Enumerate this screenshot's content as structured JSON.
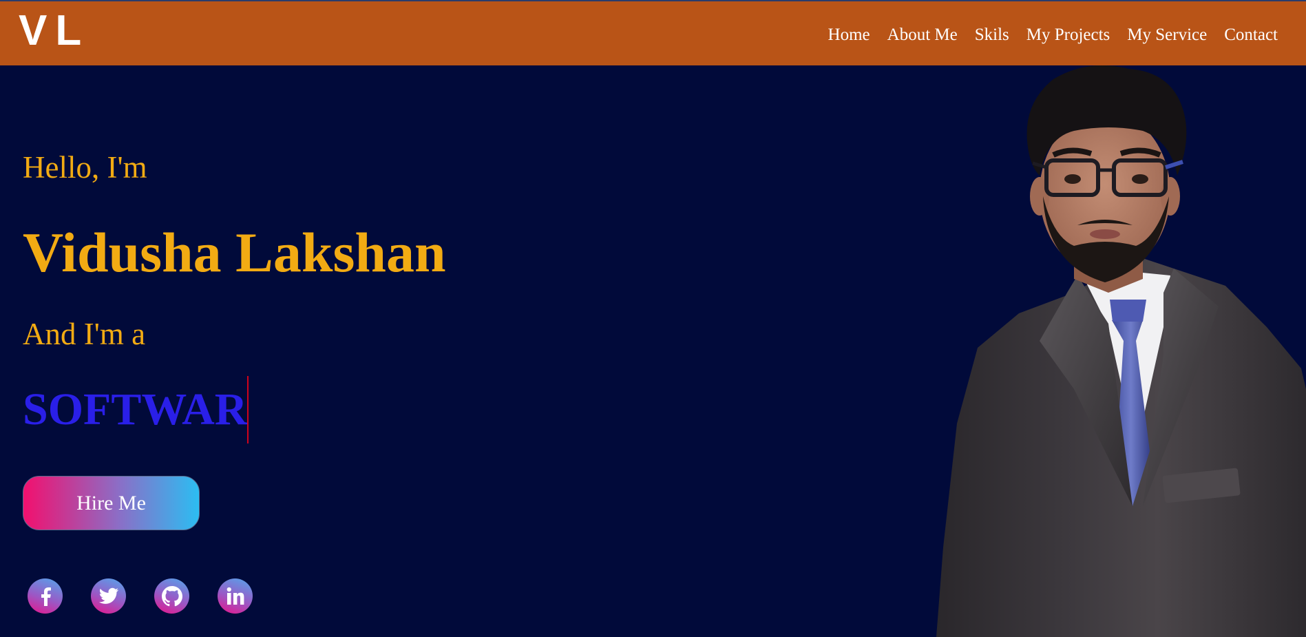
{
  "navbar": {
    "logo": "VL",
    "links": [
      "Home",
      "About Me",
      "Skils",
      "My Projects",
      "My Service",
      "Contact"
    ]
  },
  "hero": {
    "greeting": "Hello, I'm",
    "name": "Vidusha Lakshan",
    "role_intro": "And I'm a",
    "typed_text": "SOFTWAR",
    "hire_button": "Hire Me"
  },
  "socials": [
    {
      "icon": "facebook-icon"
    },
    {
      "icon": "twitter-icon"
    },
    {
      "icon": "github-icon"
    },
    {
      "icon": "linkedin-icon"
    }
  ],
  "colors": {
    "navbar_bg": "#b95417",
    "page_bg": "#010a3a",
    "accent_yellow": "#f2ab13",
    "typed_blue": "#2a1fe8",
    "cursor_red": "#d0021b"
  }
}
